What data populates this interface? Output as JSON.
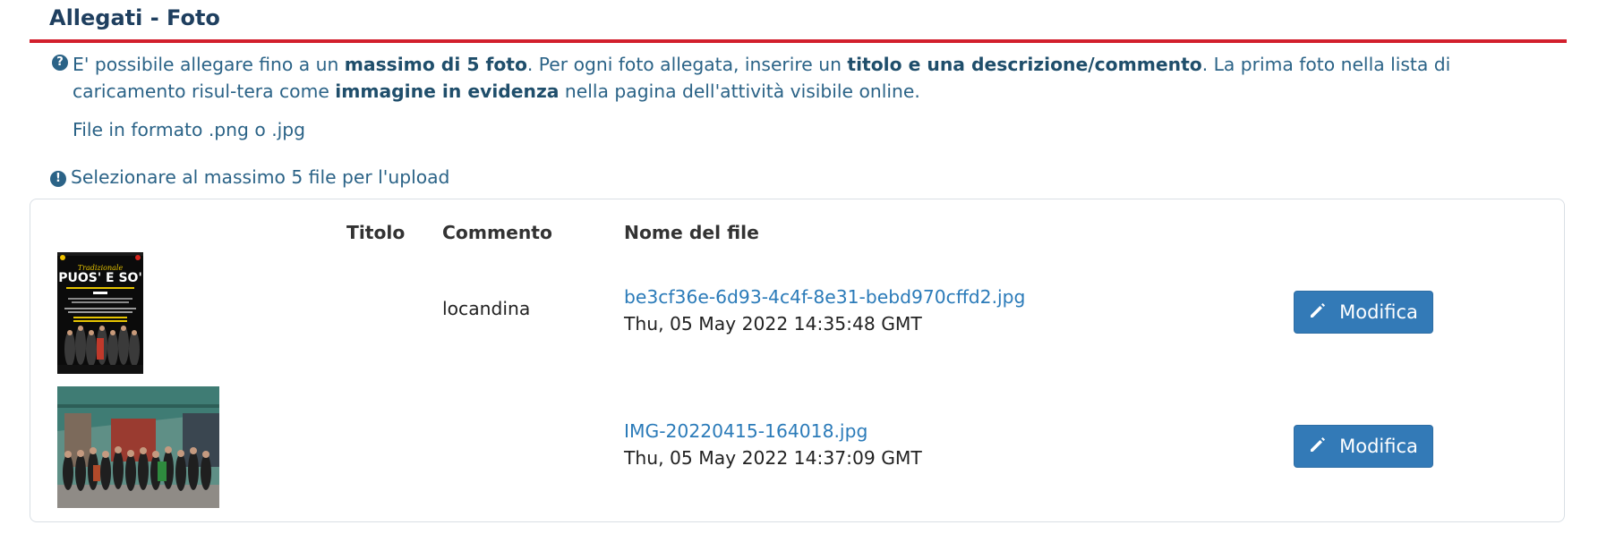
{
  "section": {
    "title": "Allegati - Foto"
  },
  "help": {
    "parts": [
      "E' possibile allegare fino a un ",
      "massimo di 5 foto",
      ". Per ogni foto allegata, inserire un ",
      "titolo e una descrizione/commento",
      ". La prima foto nella lista di caricamento risul-tera come ",
      "immagine in evidenza",
      " nella pagina dell'attività visibile online."
    ],
    "format": "File in formato .png o .jpg",
    "upload_limit": "Selezionare al massimo 5 file per l'upload"
  },
  "table": {
    "headers": {
      "title": "Titolo",
      "comment": "Commento",
      "filename": "Nome del file"
    },
    "rows": [
      {
        "title": "",
        "comment": "locandina",
        "filename": "be3cf36e-6d93-4c4f-8e31-bebd970cffd2.jpg",
        "date": "Thu, 05 May 2022 14:35:48 GMT",
        "button": "Modifica",
        "thumb_text": {
          "top": "Tradizionale",
          "main": "PUOS' E SO'"
        }
      },
      {
        "title": "",
        "comment": "",
        "filename": "IMG-20220415-164018.jpg",
        "date": "Thu, 05 May 2022 14:37:09 GMT",
        "button": "Modifica"
      }
    ]
  },
  "icons": {
    "info": "question-circle-icon",
    "warning": "exclamation-circle-icon",
    "edit": "pencil-icon"
  },
  "colors": {
    "accent": "#337ab7",
    "title": "#1f3f5f",
    "divider": "#d21f2d",
    "help_text": "#2b6387"
  }
}
